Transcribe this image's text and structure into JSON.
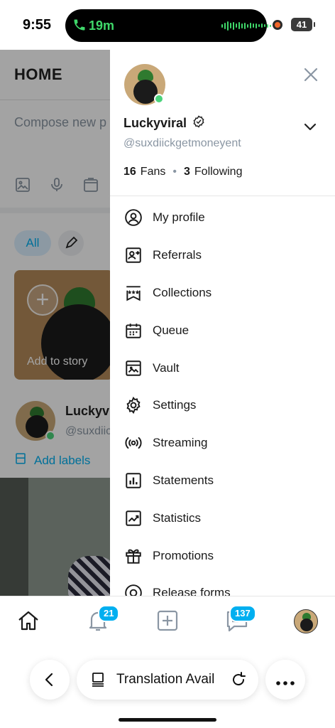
{
  "status_bar": {
    "time": "9:55",
    "call_duration": "19m",
    "battery": "41"
  },
  "background_page": {
    "title": "HOME",
    "compose_placeholder": "Compose new p",
    "chip_all": "All",
    "story_caption": "Add to story",
    "post_name": "Luckyvi",
    "post_handle": "@suxdiic",
    "add_labels": "Add labels"
  },
  "drawer": {
    "display_name": "Luckyviral",
    "handle": "@suxdiickgetmoneyent",
    "fans_count": "16",
    "fans_label": "Fans",
    "following_count": "3",
    "following_label": "Following",
    "separator": "•",
    "menu": [
      {
        "label": "My profile",
        "icon": "profile-icon"
      },
      {
        "label": "Referrals",
        "icon": "referrals-icon"
      },
      {
        "label": "Collections",
        "icon": "collections-icon"
      },
      {
        "label": "Queue",
        "icon": "queue-icon"
      },
      {
        "label": "Vault",
        "icon": "vault-icon"
      },
      {
        "label": "Settings",
        "icon": "settings-icon"
      },
      {
        "label": "Streaming",
        "icon": "streaming-icon"
      },
      {
        "label": "Statements",
        "icon": "statements-icon"
      },
      {
        "label": "Statistics",
        "icon": "statistics-icon"
      },
      {
        "label": "Promotions",
        "icon": "promotions-icon"
      },
      {
        "label": "Release forms",
        "icon": "release-forms-icon"
      }
    ]
  },
  "tabbar": {
    "notifications_badge": "21",
    "messages_badge": "137"
  },
  "browser": {
    "address_text": "Translation Avail"
  },
  "colors": {
    "accent": "#00aff0",
    "online": "#4bd37b",
    "muted_text": "#8a96a3"
  }
}
